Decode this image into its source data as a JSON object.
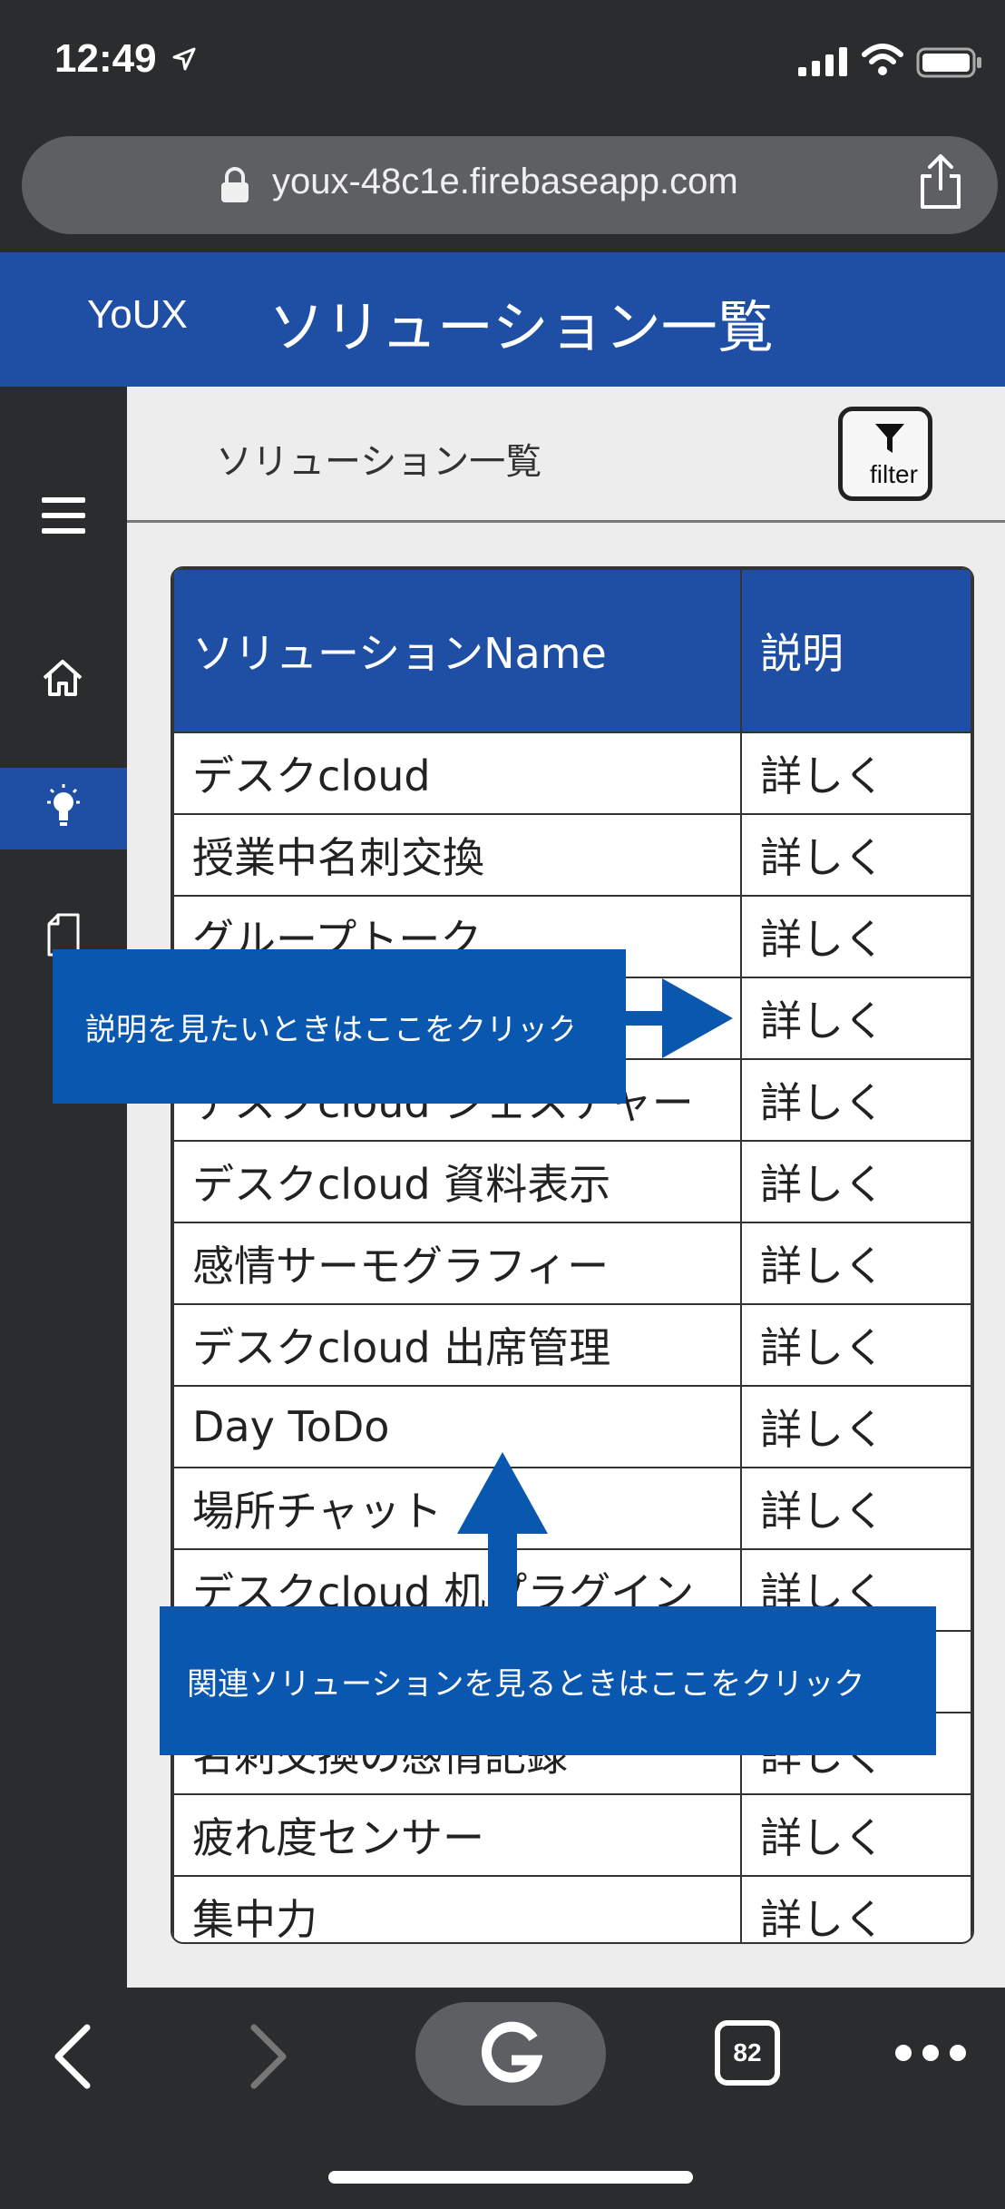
{
  "status_bar": {
    "time": "12:49"
  },
  "browser": {
    "url": "youx-48c1e.firebaseapp.com",
    "tab_count": "82"
  },
  "header": {
    "brand": "YoUX",
    "title": "ソリューション一覧"
  },
  "main": {
    "subheader_title": "ソリューション一覧",
    "filter_label": "filter",
    "table": {
      "columns": [
        "ソリューションName",
        "説明"
      ],
      "rows": [
        {
          "name": "デスクcloud",
          "desc": "詳しく"
        },
        {
          "name": "授業中名刺交換",
          "desc": "詳しく"
        },
        {
          "name": "グループトーク",
          "desc": "詳しく"
        },
        {
          "name": "",
          "desc": "詳しく"
        },
        {
          "name": "デスクcloud ジェスチャー",
          "desc": "詳しく"
        },
        {
          "name": "デスクcloud 資料表示",
          "desc": "詳しく"
        },
        {
          "name": "感情サーモグラフィー",
          "desc": "詳しく"
        },
        {
          "name": "デスクcloud 出席管理",
          "desc": "詳しく"
        },
        {
          "name": "Day ToDo",
          "desc": "詳しく"
        },
        {
          "name": "場所チャット",
          "desc": "詳しく"
        },
        {
          "name": "デスクcloud 机プラグイン",
          "desc": "詳しく"
        },
        {
          "name": "",
          "desc": ""
        },
        {
          "name": "名刺交換の感情記録",
          "desc": "詳しく"
        },
        {
          "name": "疲れ度センサー",
          "desc": "詳しく"
        },
        {
          "name": "集中力",
          "desc": "詳しく"
        }
      ]
    }
  },
  "overlays": {
    "callout_desc": "説明を見たいときはここをクリック",
    "callout_related": "関連ソリューションを見るときはここをクリック"
  },
  "colors": {
    "brand_blue": "#1e4fa4",
    "callout_blue": "#0a57b0",
    "dark_bg": "#2b2c2e"
  }
}
